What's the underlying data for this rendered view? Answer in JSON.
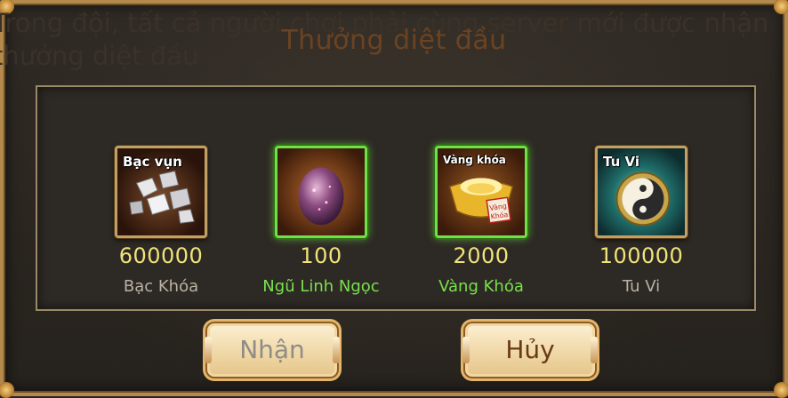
{
  "background_text": "Trong đội, tất cả người chơi phải cùng server mới được nhận thưởng diệt đầu",
  "dialog": {
    "title": "Thưởng diệt đầu"
  },
  "rewards": [
    {
      "icon": "silver-chunks-icon",
      "tag": "Bạc vụn",
      "quantity": "600000",
      "name": "Bạc Khóa",
      "frame": "gold"
    },
    {
      "icon": "purple-gem-egg-icon",
      "tag": "",
      "quantity": "100",
      "name": "Ngũ Linh Ngọc",
      "frame": "green"
    },
    {
      "icon": "gold-ingot-icon",
      "tag": "Vàng khóa",
      "quantity": "2000",
      "name": "Vàng Khóa",
      "frame": "green"
    },
    {
      "icon": "yin-yang-icon",
      "tag": "Tu Vi",
      "quantity": "100000",
      "name": "Tu Vi",
      "frame": "gold"
    }
  ],
  "buttons": {
    "receive_label": "Nhận",
    "cancel_label": "Hủy"
  },
  "colors": {
    "quantity_yellow": "#f2e27a",
    "name_green": "#79e04d",
    "name_grey": "#bbb2a3",
    "title_brown": "#6b4322"
  }
}
